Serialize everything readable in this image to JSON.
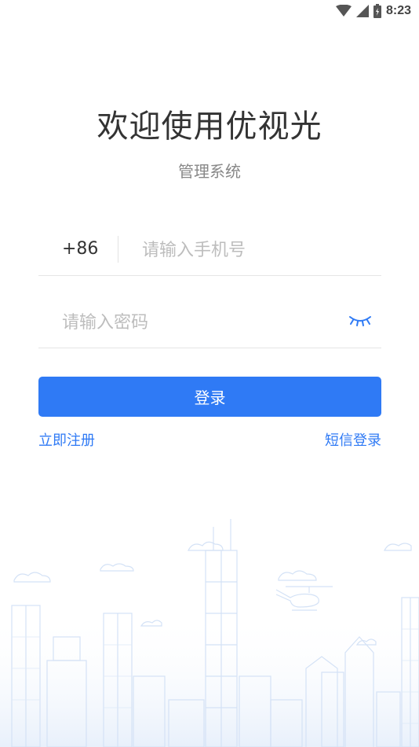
{
  "status_bar": {
    "time": "8:23",
    "icons": [
      "wifi-icon",
      "signal-icon",
      "battery-icon"
    ]
  },
  "header": {
    "title": "欢迎使用优视光",
    "subtitle": "管理系统"
  },
  "form": {
    "country_code": "+86",
    "phone_placeholder": "请输入手机号",
    "phone_value": "",
    "password_placeholder": "请输入密码",
    "password_value": "",
    "password_toggle_icon": "eye-closed-icon",
    "login_label": "登录"
  },
  "links": {
    "register": "立即注册",
    "sms_login": "短信登录"
  },
  "colors": {
    "accent": "#2f7af5",
    "illustration": "#dde8f7"
  }
}
